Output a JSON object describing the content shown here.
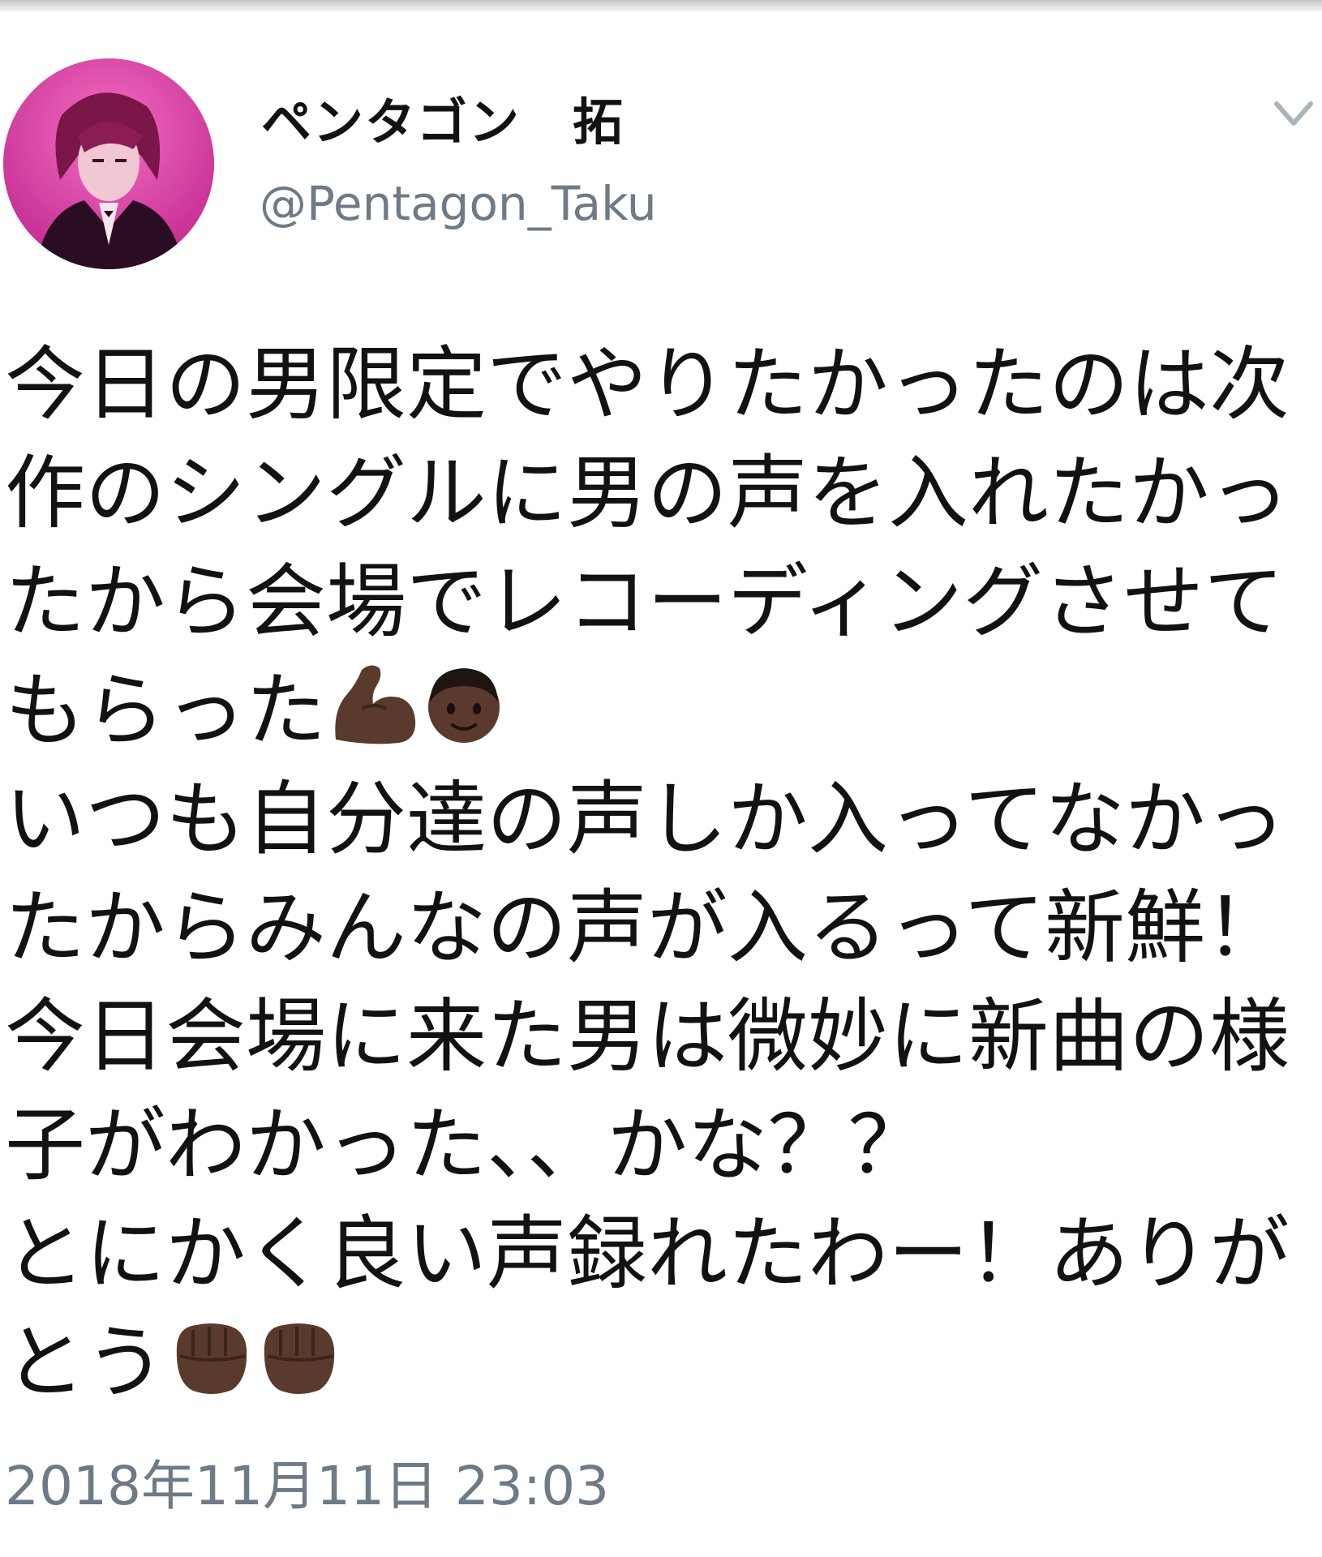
{
  "tweet": {
    "display_name": "ペンタゴン　拓",
    "handle": "@Pentagon_Taku",
    "menu_icon": "chevron-down-icon",
    "lines": [
      "今日の男限定でやりたかったのは次",
      "作のシングルに男の声を入れたかっ",
      "たから会場でレコーディングさせて",
      "もらった",
      "いつも自分達の声しか入ってなかっ",
      "たからみんなの声が入るって新鮮！",
      "今日会場に来た男は微妙に新曲の様",
      "子がわかった、、かな？？",
      "とにかく良い声録れたわー！ありが",
      "とう"
    ],
    "emoji_line_4": [
      "flexed-biceps-emoji",
      "boy-emoji"
    ],
    "emoji_line_10": [
      "oncoming-fist-emoji",
      "oncoming-fist-emoji"
    ],
    "timestamp": "2018年11月11日 23:03"
  },
  "colors": {
    "avatar_bg": "#e23ea6",
    "handle_text": "#6e7a86",
    "emoji_skin": "#5a3a2c"
  }
}
